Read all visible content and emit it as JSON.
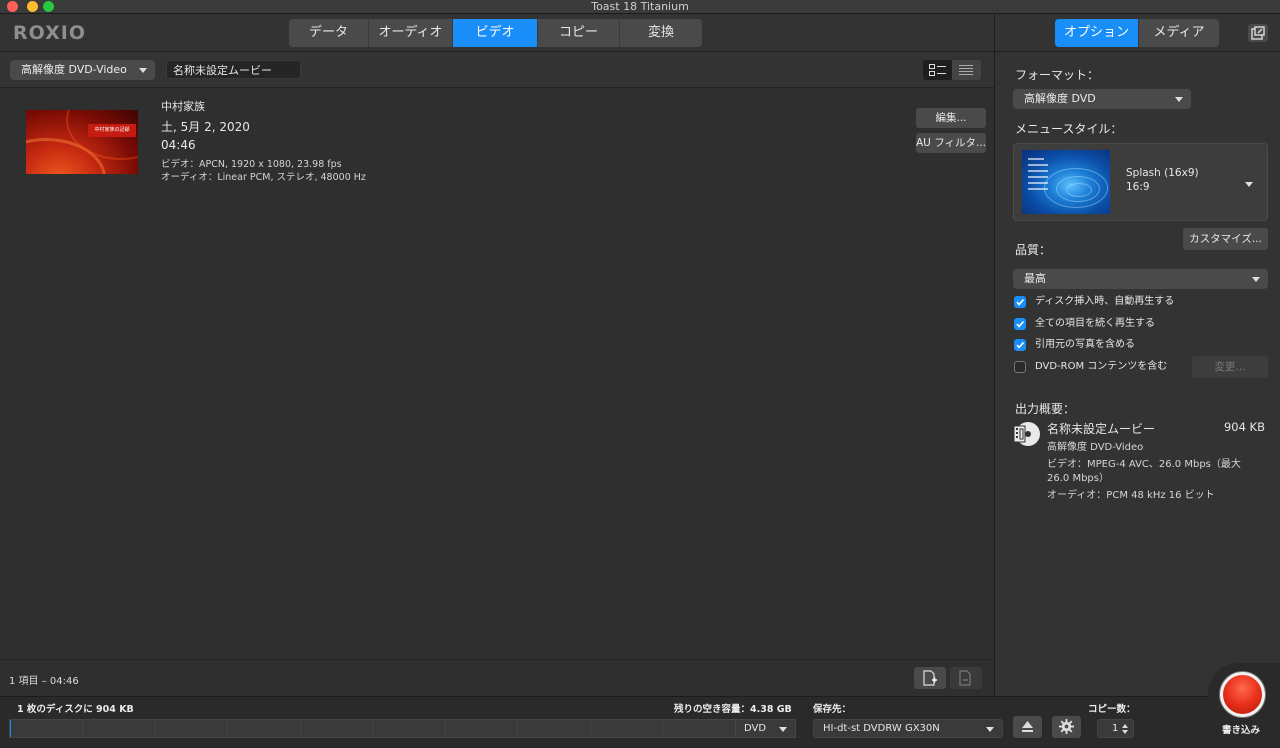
{
  "window": {
    "title": "Toast 18 Titanium"
  },
  "toolbar": {
    "logo": "ROXIO",
    "main_tabs": [
      {
        "label": "データ",
        "active": false
      },
      {
        "label": "オーディオ",
        "active": false
      },
      {
        "label": "ビデオ",
        "active": true
      },
      {
        "label": "コピー",
        "active": false
      },
      {
        "label": "変換",
        "active": false
      }
    ],
    "right_tabs": [
      {
        "label": "オプション",
        "active": true
      },
      {
        "label": "メディア",
        "active": false
      }
    ]
  },
  "project": {
    "format": "高解像度 DVD-Video",
    "title": "名称未設定ムービー"
  },
  "item": {
    "title": "中村家族",
    "date": "土, 5月 2, 2020",
    "duration": "04:46",
    "video": "ビデオ：APCN, 1920 x 1080, 23.98 fps",
    "audio": "オーディオ：Linear PCM, ステレオ, 48000 Hz",
    "thumbnail_caption": "中村家族の記録",
    "edit_label": "編集...",
    "filter_label": "AU フィルタ..."
  },
  "status": {
    "count": "1 項目 – 04:46"
  },
  "options": {
    "format_label": "フォーマット：",
    "format_value": "高解像度 DVD",
    "menu_style_label": "メニュースタイル：",
    "menu_style_name": "Splash (16x9)",
    "menu_style_ratio": "16:9",
    "customize_label": "カスタマイズ...",
    "quality_label": "品質：",
    "quality_value": "最高",
    "checkboxes": [
      {
        "label": "ディスク挿入時、自動再生する",
        "checked": true
      },
      {
        "label": "全ての項目を続く再生する",
        "checked": true
      },
      {
        "label": "引用元の写真を含める",
        "checked": true
      },
      {
        "label": "DVD-ROM コンテンツを含む",
        "checked": false
      }
    ],
    "change_label": "変更...",
    "output_label": "出力概要：",
    "output_name": "名称未設定ムービー",
    "output_size": "904 KB",
    "output_type": "高解像度 DVD-Video",
    "output_video": "ビデオ：MPEG-4 AVC、26.0 Mbps（最大 26.0 Mbps）",
    "output_audio": "オーディオ：PCM 48 kHz 16 ビット"
  },
  "bottom": {
    "disc_usage": "1 枚のディスクに 904 KB",
    "free_space": "残りの空き容量：4.38 GB",
    "disc_fill_fraction": 0.0002,
    "disc_type": "DVD",
    "dest_label": "保存先：",
    "drive": "HI-dt-st DVDRW  GX30N",
    "copies_label": "コピー数：",
    "copies": "1",
    "burn_label": "書き込み"
  },
  "colors": {
    "accent": "#1a8ef8",
    "burn": "#e8301b"
  }
}
